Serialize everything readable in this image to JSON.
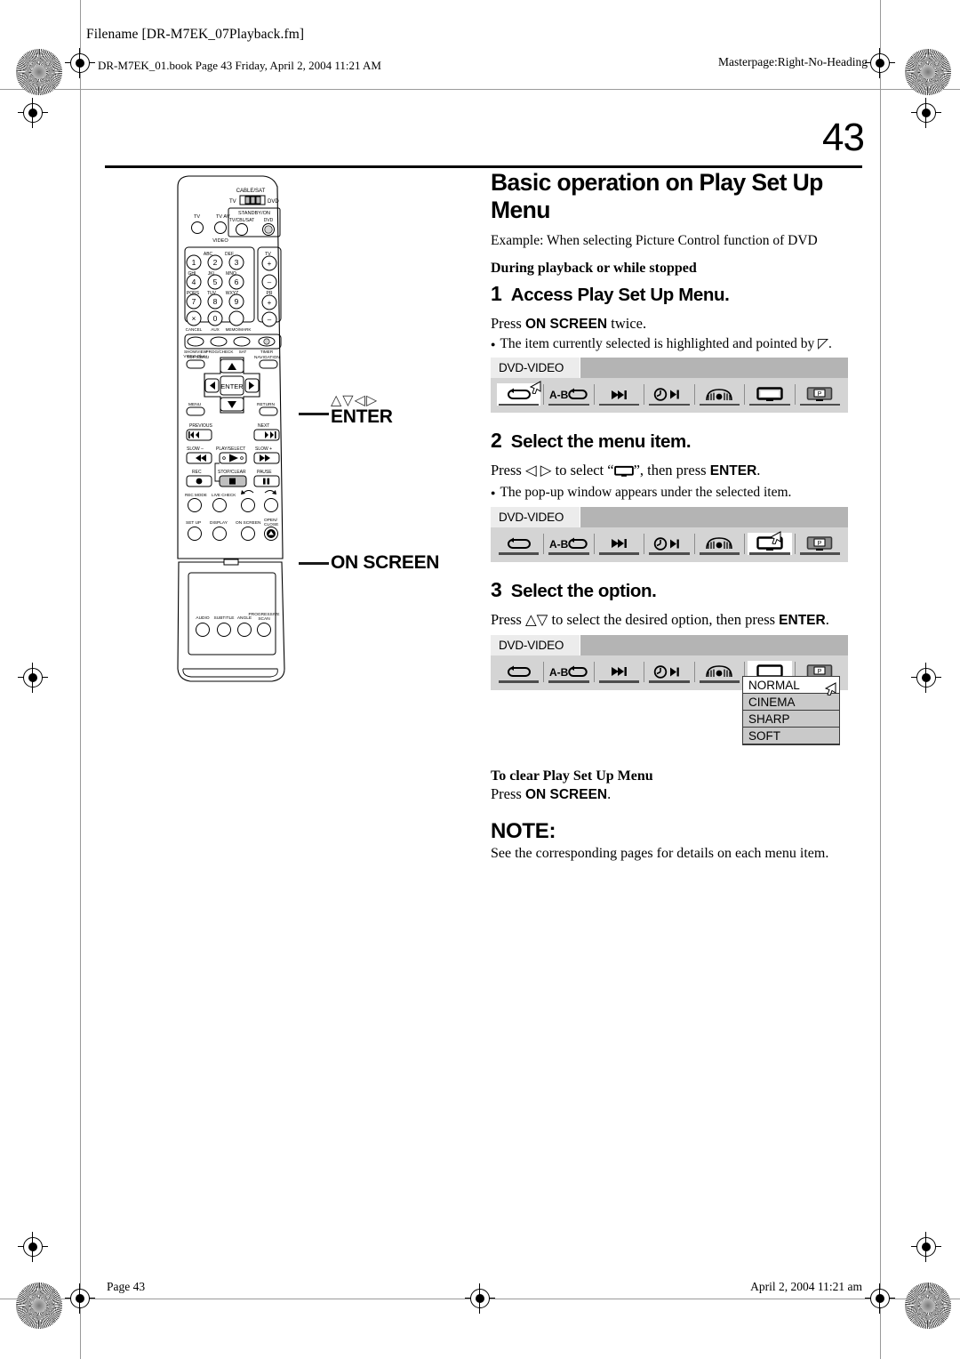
{
  "printer_marks": {
    "filename": "Filename [DR-M7EK_07Playback.fm]",
    "book_line": "DR-M7EK_01.book  Page 43  Friday, April 2, 2004  11:21 AM",
    "masterpage": "Masterpage:Right-No-Heading",
    "page_footer": "Page 43",
    "date_footer": "April 2, 2004 11:21 am"
  },
  "page": {
    "folio": "43",
    "title": "Basic operation on Play Set Up Menu",
    "example": "Example: When selecting Picture Control function of DVD",
    "subhead": "During playback or while stopped"
  },
  "steps": [
    {
      "num": "1",
      "title": "Access Play Set Up Menu.",
      "body_pre": "Press ",
      "body_bold": "ON SCREEN",
      "body_post": " twice.",
      "bullet": "The item currently selected is highlighted and pointed by ◸."
    },
    {
      "num": "2",
      "title": "Select the menu item.",
      "body_pre": "Press ",
      "body_arrows": "◁ ▷",
      "body_mid": " to select “",
      "body_icon": "tv-screen-icon",
      "body_mid2": "”, then press ",
      "body_bold": "ENTER",
      "body_post": ".",
      "bullet": "The pop-up window appears under the selected item."
    },
    {
      "num": "3",
      "title": "Select the option.",
      "body_pre": "Press ",
      "body_arrows": "△▽",
      "body_mid": " to select the desired option, then press ",
      "body_bold": "ENTER",
      "body_post": "."
    }
  ],
  "osd": {
    "tab_label": "DVD-VIDEO",
    "buttons": [
      {
        "name": "repeat-icon",
        "label": ""
      },
      {
        "name": "ab-repeat-icon",
        "label": "A-B"
      },
      {
        "name": "skip-search-icon",
        "label": ""
      },
      {
        "name": "time-search-icon",
        "label": ""
      },
      {
        "name": "surround-audio-icon",
        "label": ""
      },
      {
        "name": "picture-control-icon",
        "label": ""
      },
      {
        "name": "screen-mode-icon",
        "label": ""
      }
    ],
    "selected_step1": 0,
    "selected_step2": 5,
    "selected_step3": 5
  },
  "popup": {
    "options": [
      "NORMAL",
      "CINEMA",
      "SHARP",
      "SOFT"
    ],
    "selected": "NORMAL"
  },
  "closing": {
    "clear_head": "To clear Play Set Up Menu",
    "clear_pre": "Press ",
    "clear_bold": "ON SCREEN",
    "clear_post": ".",
    "note_head": "NOTE:",
    "note_body": "See the corresponding pages for details on each menu item."
  },
  "callouts": {
    "arrows": "△▽◁▷",
    "enter": "ENTER",
    "on_screen": "ON SCREEN"
  },
  "remote": {
    "top": {
      "cable_sat": "CABLE/SAT",
      "switch_left": "TV",
      "switch_right": "DVD",
      "standby": "STANDBY/ON",
      "tv_cbl_sat": "TV/CBL/SAT",
      "dvd": "DVD",
      "tv_mute": "TV",
      "tv_av": "TV AV",
      "video": "VIDEO"
    },
    "keypad": {
      "keys": [
        "1",
        "2",
        "3",
        "4",
        "5",
        "6",
        "7",
        "8",
        "9",
        "×",
        "0",
        ""
      ],
      "letters": [
        "",
        "ABC",
        "DEF",
        "GHI",
        "JKL",
        "MNO",
        "PQRS",
        "TUV",
        "WXYZ"
      ],
      "cancel": "CANCEL",
      "aux": "AUX",
      "memo": "MEMO/MARK"
    },
    "side": {
      "tv_vol": "TV",
      "plus1": "+",
      "minus1": "–",
      "pr": "PR",
      "plus2": "+",
      "minus2": "–"
    },
    "func_row": [
      "SHOWVIEW",
      "PROG/CHECK",
      "SAT",
      "TIMER"
    ],
    "func_sub": "VIDEO Plus+",
    "nav": {
      "top_menu": "TOP MENU",
      "navigation": "NAVIGATION",
      "enter": "ENTER",
      "menu": "MENU",
      "return": "RETURN"
    },
    "transport": {
      "previous": "PREVIOUS",
      "next": "NEXT",
      "slow_minus": "SLOW –",
      "play_select": "PLAY/SELECT",
      "slow_plus": "SLOW +",
      "rec": "REC",
      "stop_clear": "STOP/CLEAR",
      "pause": "PAUSE"
    },
    "bottom_row1": [
      "REC MODE",
      "LIVE CHECK"
    ],
    "bottom_row2": [
      "SET UP",
      "DISPLAY",
      "ON SCREEN",
      "OPEN/CLOSE"
    ],
    "flap": [
      "AUDIO",
      "SUBTITLE",
      "ANGLE",
      "PROGRESSIVE SCAN"
    ]
  }
}
